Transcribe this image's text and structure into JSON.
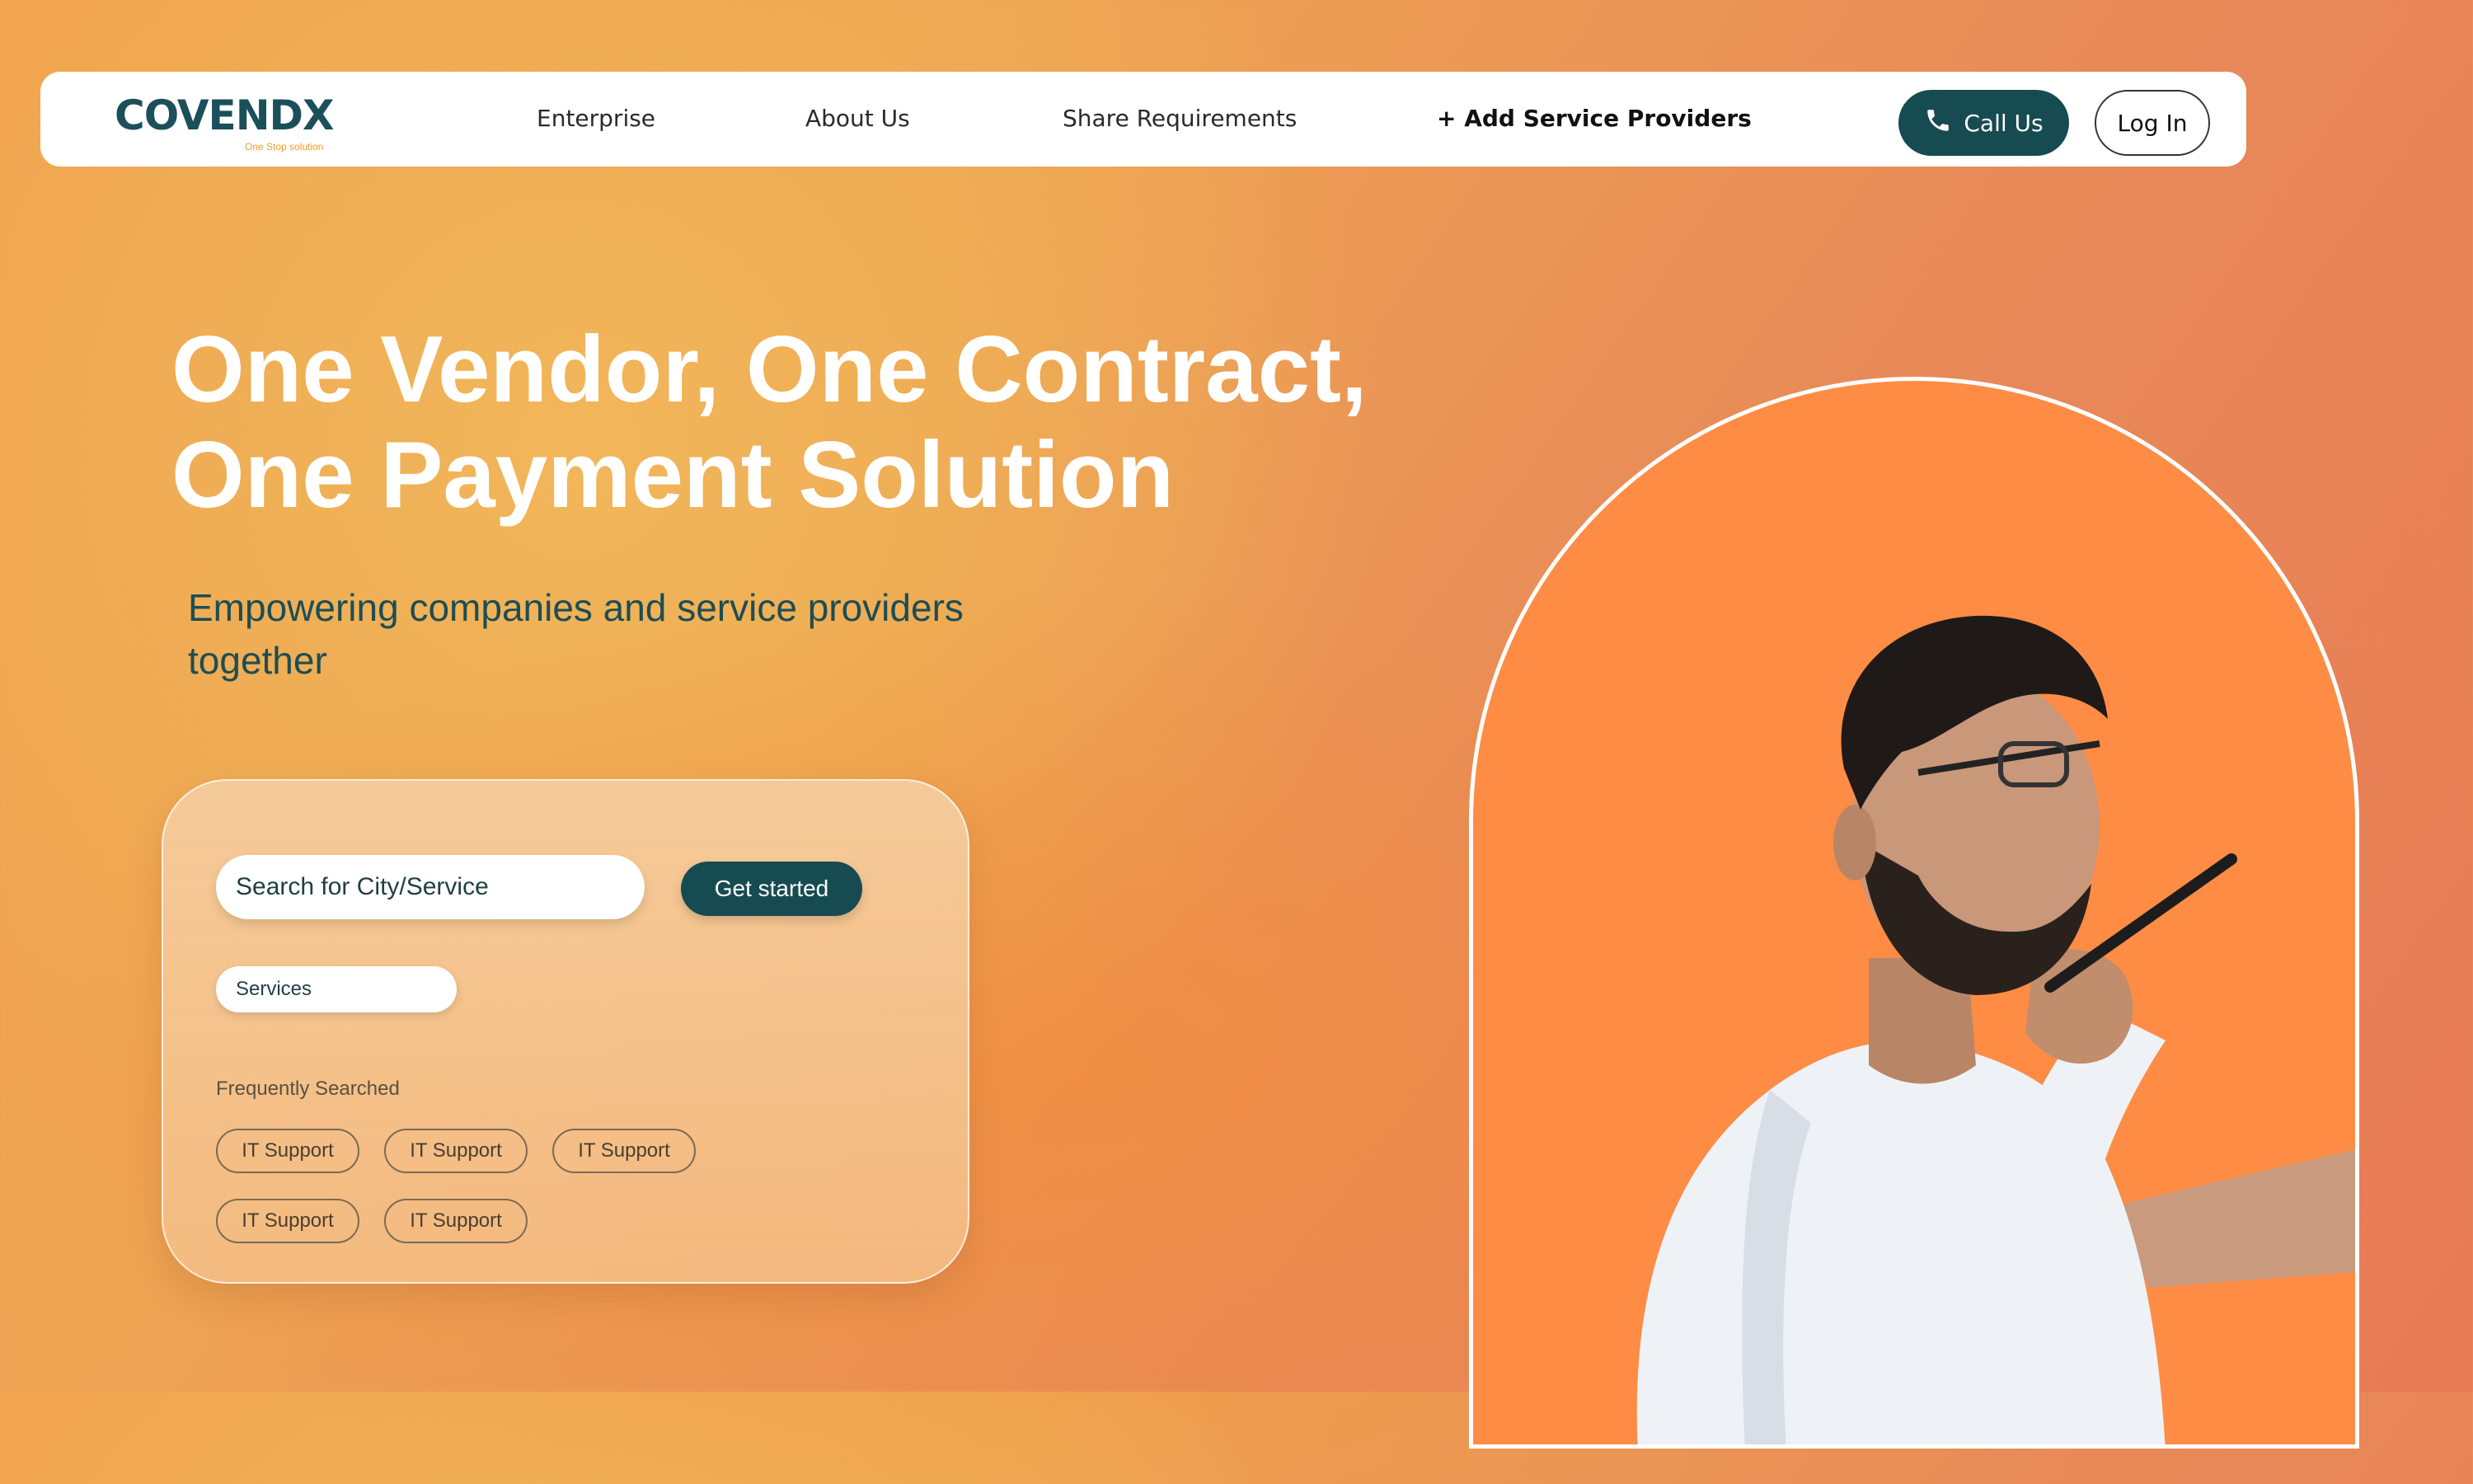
{
  "brand": {
    "name": "COVENDX",
    "tagline": "One Stop solution",
    "colors": {
      "primary": "#174b52",
      "accent": "#f39c2c",
      "hero_bg": "#f0a04f",
      "arch_bg": "#ff8c45"
    }
  },
  "nav": {
    "links": [
      "Enterprise",
      "About Us",
      "Share Requirements",
      "+ Add Service Providers"
    ],
    "call_label": "Call Us",
    "call_icon": "phone-icon",
    "login_label": "Log In"
  },
  "hero": {
    "title_line1": "One Vendor, One Contract,",
    "title_line2": "One Payment Solution",
    "subtitle": "Empowering companies and service providers together"
  },
  "search": {
    "placeholder": "Search for City/Service",
    "button_label": "Get started",
    "services_label": "Services",
    "frequent_label": "Frequently Searched",
    "frequent_items": [
      "IT Support",
      "IT Support",
      "IT Support",
      "IT Support",
      "IT Support"
    ]
  }
}
